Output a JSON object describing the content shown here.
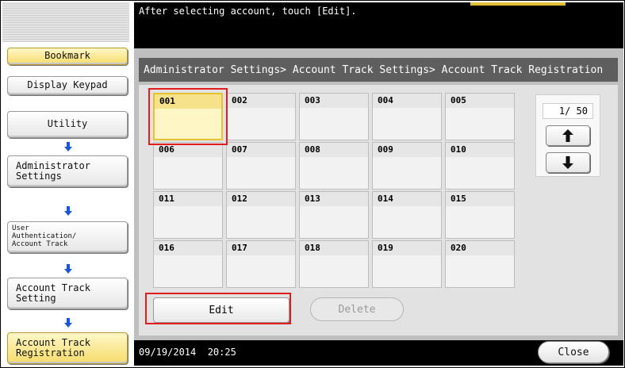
{
  "instruction": "After selecting account, touch [Edit].",
  "breadcrumb": "Administrator Settings> Account Track Settings> Account Track Registration",
  "left_nav": {
    "bookmark": "Bookmark",
    "display_keypad": "Display Keypad",
    "utility": "Utility",
    "administrator_settings": "Administrator\nSettings",
    "user_auth": "User\nAuthentication/\nAccount Track",
    "account_track_setting": "Account Track\nSetting",
    "account_track_registration": "Account Track\nRegistration"
  },
  "accounts": [
    "001",
    "002",
    "003",
    "004",
    "005",
    "006",
    "007",
    "008",
    "009",
    "010",
    "011",
    "012",
    "013",
    "014",
    "015",
    "016",
    "017",
    "018",
    "019",
    "020"
  ],
  "selected_account": "001",
  "page_indicator": "1/ 50",
  "buttons": {
    "edit": "Edit",
    "delete": "Delete",
    "close": "Close"
  },
  "status": {
    "date": "09/19/2014",
    "time": "20:25"
  },
  "icons": {
    "page_up": "arrow-up-icon",
    "page_down": "arrow-down-icon",
    "nav_arrow": "arrow-down-icon"
  },
  "colors": {
    "highlight_red": "#e21d1d",
    "selected_yellow": "#f6dc6a",
    "nav_arrow_blue": "#1a56d6"
  }
}
